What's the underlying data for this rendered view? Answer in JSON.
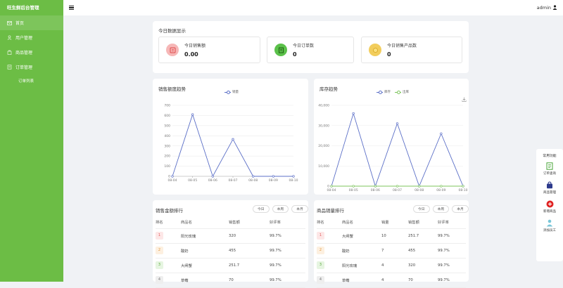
{
  "brand": "旺生鲜后台管理",
  "sidebar": {
    "items": [
      {
        "label": "首页",
        "icon": "mail-icon"
      },
      {
        "label": "用户管理",
        "icon": "user-icon"
      },
      {
        "label": "商品管理",
        "icon": "goods-icon"
      },
      {
        "label": "订单管理",
        "icon": "order-icon"
      }
    ],
    "sub": "订单列表"
  },
  "topbar": {
    "user": "admin"
  },
  "today": {
    "title": "今日数据显示",
    "stats": [
      {
        "label": "今日销售额",
        "value": "0.00",
        "color": "#f6b7b7",
        "icon_color": "#e04848"
      },
      {
        "label": "今日订单数",
        "value": "0",
        "color": "#5bc14a",
        "icon_color": "#2e8a1f"
      },
      {
        "label": "今日销售产品数",
        "value": "0",
        "color": "#f2cd5c",
        "icon_color": "#d6a41c"
      }
    ]
  },
  "sales_chart_title": "销售额度趋势",
  "stock_chart_title": "库存趋势",
  "chart_data": [
    {
      "type": "line",
      "title": "销售额度趋势",
      "x": [
        "08-04",
        "08-05",
        "08-06",
        "08-07",
        "08-08",
        "08-09",
        "08-10"
      ],
      "series": [
        {
          "name": "销量",
          "values": [
            0,
            610,
            0,
            365,
            0,
            0,
            0
          ],
          "color": "#5b6fc7"
        }
      ],
      "ylim": [
        0,
        700
      ],
      "yticks": [
        "0",
        "100",
        "200",
        "300",
        "400",
        "500",
        "600",
        "700"
      ],
      "legend": "top-center",
      "grid": true
    },
    {
      "type": "line",
      "title": "库存趋势",
      "x": [
        "08-04",
        "08-05",
        "08-06",
        "08-07",
        "08-08",
        "08-09",
        "08-10"
      ],
      "series": [
        {
          "name": "库存",
          "values": [
            0,
            36000,
            0,
            31000,
            0,
            26000,
            0
          ],
          "color": "#5b6fc7"
        },
        {
          "name": "出库",
          "values": [
            0,
            0,
            0,
            0,
            0,
            0,
            0
          ],
          "color": "#7cc45b"
        }
      ],
      "ylim": [
        0,
        40000
      ],
      "yticks": [
        "0",
        "10,000",
        "20,000",
        "30,000",
        "40,000"
      ],
      "legend": "top-center",
      "grid": true
    }
  ],
  "sales_rank": {
    "title": "销售金额排行",
    "tabs": [
      "今日",
      "本周",
      "本月"
    ],
    "headers": [
      "排名",
      "商品名",
      "销售额",
      "好评率"
    ],
    "rows": [
      [
        "1",
        "阳光玫瑰",
        "320",
        "99.7%"
      ],
      [
        "2",
        "酸奶",
        "455",
        "99.7%"
      ],
      [
        "3",
        "大闸蟹",
        "251.7",
        "99.7%"
      ],
      [
        "4",
        "草莓",
        "70",
        "99.7%"
      ]
    ]
  },
  "qty_rank": {
    "title": "商品销量排行",
    "tabs": [
      "今日",
      "本周",
      "本月"
    ],
    "headers": [
      "排名",
      "商品名",
      "销量",
      "销售额",
      "好评率"
    ],
    "rows": [
      [
        "1",
        "大闸蟹",
        "10",
        "251.7",
        "99.7%"
      ],
      [
        "2",
        "酸奶",
        "7",
        "455",
        "99.7%"
      ],
      [
        "3",
        "阳光玫瑰",
        "4",
        "320",
        "99.7%"
      ],
      [
        "4",
        "草莓",
        "4",
        "70",
        "99.7%"
      ]
    ]
  },
  "quick": {
    "title": "常用功能",
    "items": [
      {
        "label": "订单查询",
        "icon": "order-query-icon",
        "color": "#4aa63a"
      },
      {
        "label": "商品管理",
        "icon": "bag-icon",
        "color": "#2d3a8c"
      },
      {
        "label": "新增商品",
        "icon": "plus-icon",
        "color": "#e02424"
      },
      {
        "label": "添加员工",
        "icon": "person-icon",
        "color": "#79c6d8"
      }
    ]
  }
}
